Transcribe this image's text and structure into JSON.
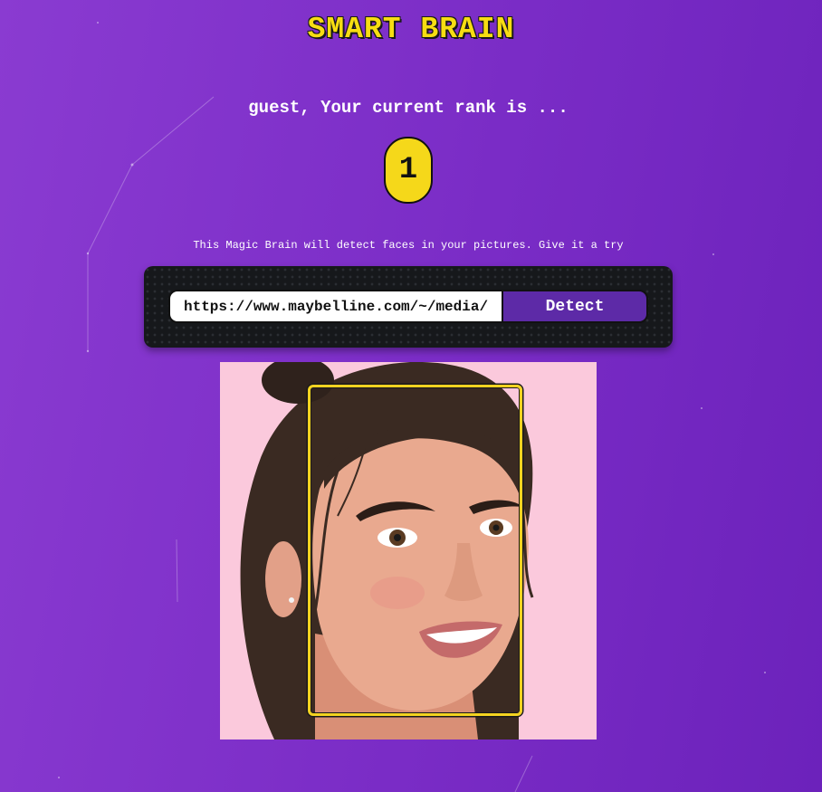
{
  "app": {
    "title": "SMART BRAIN"
  },
  "rank": {
    "message": "guest, Your current rank is ...",
    "value": "1"
  },
  "image_form": {
    "description": "This Magic Brain will detect faces in your pictures. Give it a try",
    "url_value": "https://www.maybelline.com/~/media/",
    "detect_label": "Detect"
  },
  "colors": {
    "background": "#7b2dc6",
    "accent_yellow": "#f5d81a",
    "button_purple": "#5d2aa7",
    "panel_dark": "#16181b",
    "photo_background": "#fbc9dc"
  },
  "icons": {
    "face_detection": "face-bounding-box"
  }
}
